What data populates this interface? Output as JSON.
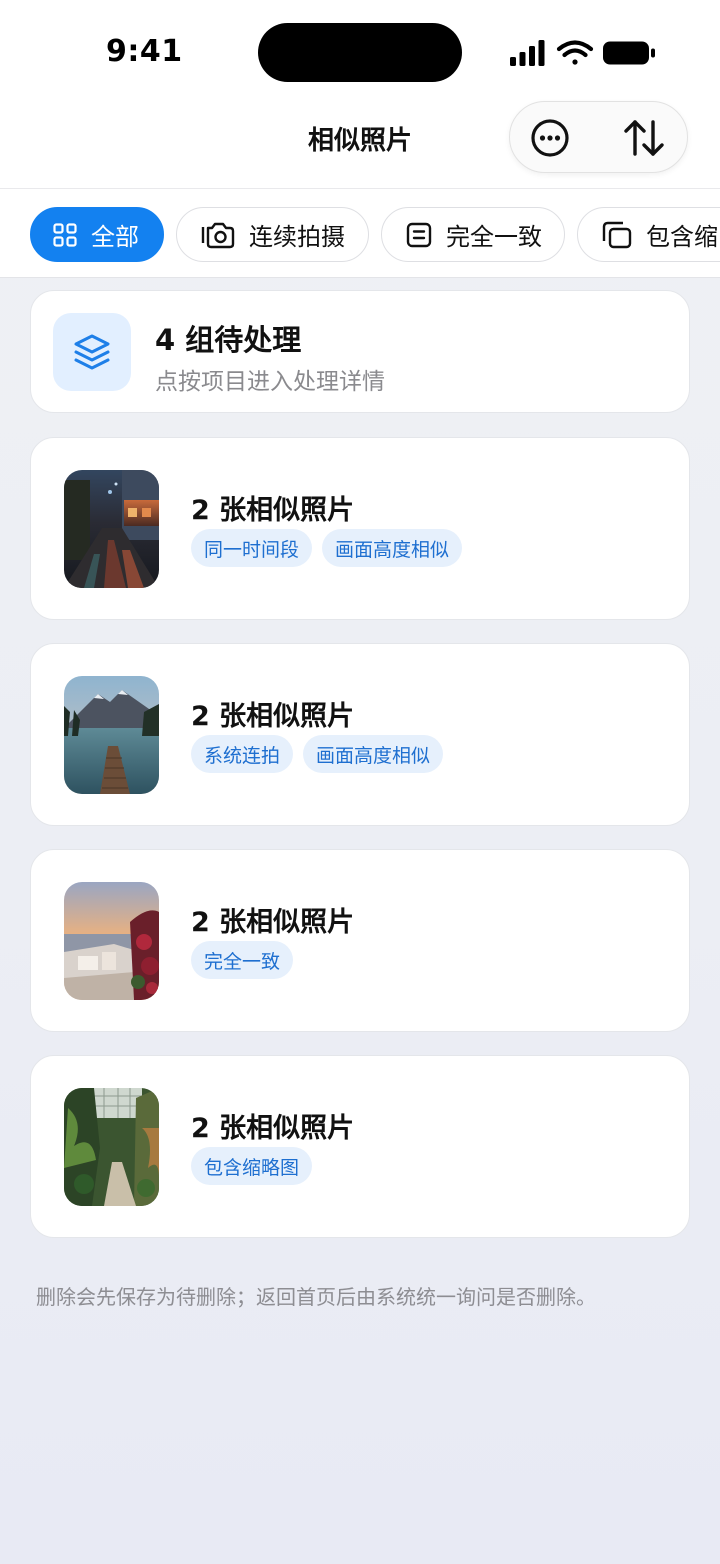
{
  "status_bar": {
    "time": "9:41"
  },
  "nav": {
    "title": "相似照片"
  },
  "filters": [
    {
      "label": "全部",
      "icon": "grid-icon",
      "active": true
    },
    {
      "label": "连续拍摄",
      "icon": "camera-icon",
      "active": false
    },
    {
      "label": "完全一致",
      "icon": "document-icon",
      "active": false
    },
    {
      "label": "包含缩",
      "icon": "copy-icon",
      "active": false
    }
  ],
  "summary": {
    "title": "4 组待处理",
    "subtitle": "点按项目进入处理详情",
    "icon": "layers-icon"
  },
  "groups": [
    {
      "title": "2 张相似照片",
      "tags": [
        "同一时间段",
        "画面高度相似"
      ]
    },
    {
      "title": "2 张相似照片",
      "tags": [
        "系统连拍",
        "画面高度相似"
      ]
    },
    {
      "title": "2 张相似照片",
      "tags": [
        "完全一致"
      ]
    },
    {
      "title": "2 张相似照片",
      "tags": [
        "包含缩略图"
      ]
    }
  ],
  "footnote": "删除会先保存为待删除；返回首页后由系统统一询问是否删除。",
  "colors": {
    "accent": "#1381f0",
    "tag_bg": "#e6f0fc",
    "tag_text": "#1e6fd0"
  }
}
